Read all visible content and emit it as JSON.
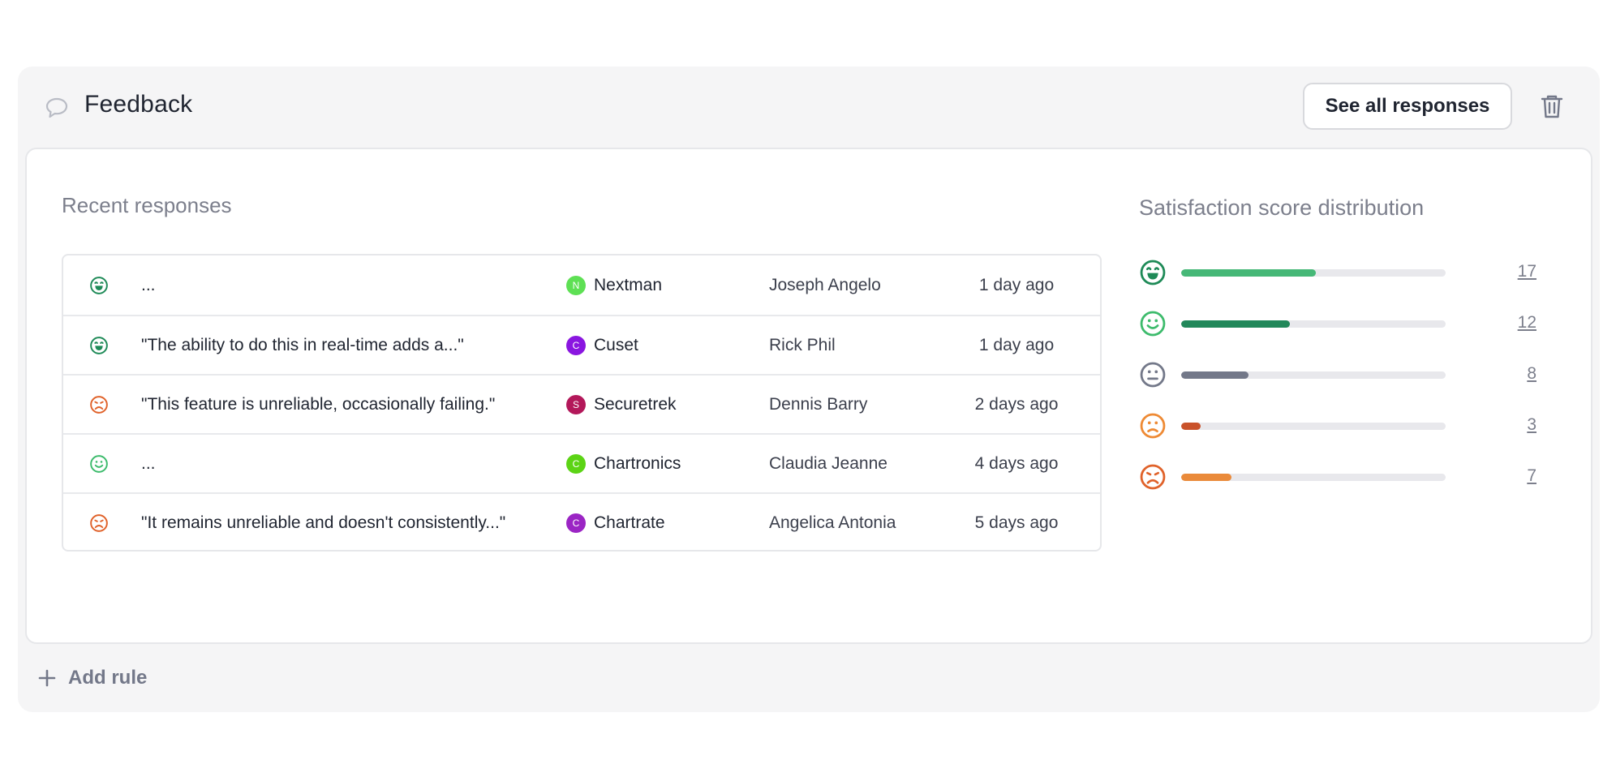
{
  "widget": {
    "title": "Feedback",
    "see_all_label": "See all responses",
    "add_rule_label": "Add rule"
  },
  "recent": {
    "title": "Recent responses",
    "rows": [
      {
        "face": "very-happy",
        "color": "#1e8a57",
        "quote": "...",
        "company": "Nextman",
        "company_initial": "N",
        "badge_color": "#5ee054",
        "person": "Joseph Angelo",
        "time": "1 day ago"
      },
      {
        "face": "very-happy",
        "color": "#1e8a57",
        "quote": "\"The ability to do this in real-time adds a...\"",
        "company": "Cuset",
        "company_initial": "C",
        "badge_color": "#8a16e0",
        "person": "Rick Phil",
        "time": "1 day ago"
      },
      {
        "face": "very-sad",
        "color": "#e0622a",
        "quote": "\"This feature is unreliable, occasionally failing.\"",
        "company": "Securetrek",
        "company_initial": "S",
        "badge_color": "#b3185a",
        "person": "Dennis Barry",
        "time": "2 days ago"
      },
      {
        "face": "happy",
        "color": "#3dbb6c",
        "quote": "...",
        "company": "Chartronics",
        "company_initial": "C",
        "badge_color": "#5cd415",
        "person": "Claudia Jeanne",
        "time": "4 days ago"
      },
      {
        "face": "very-sad",
        "color": "#e0622a",
        "quote": "\"It remains unreliable and doesn't consistently...\"",
        "company": "Chartrate",
        "company_initial": "C",
        "badge_color": "#9b25c4",
        "person": "Angelica Antonia",
        "time": "5 days ago"
      }
    ]
  },
  "distribution": {
    "title": "Satisfaction score distribution",
    "items": [
      {
        "face": "very-happy",
        "color": "#1e8a57",
        "bar_color": "#46b877",
        "count": "17",
        "fill": 0.51
      },
      {
        "face": "happy",
        "color": "#3dbb6c",
        "bar_color": "#22885a",
        "count": "12",
        "fill": 0.41
      },
      {
        "face": "neutral",
        "color": "#737889",
        "bar_color": "#737889",
        "count": "8",
        "fill": 0.255
      },
      {
        "face": "sad",
        "color": "#ee8a34",
        "bar_color": "#c9522a",
        "count": "3",
        "fill": 0.075
      },
      {
        "face": "very-sad",
        "color": "#e0622a",
        "bar_color": "#ea8a3a",
        "count": "7",
        "fill": 0.19
      }
    ]
  },
  "icons": {
    "header": "speech-bubble-icon",
    "delete": "trash-icon",
    "add": "plus-icon"
  }
}
